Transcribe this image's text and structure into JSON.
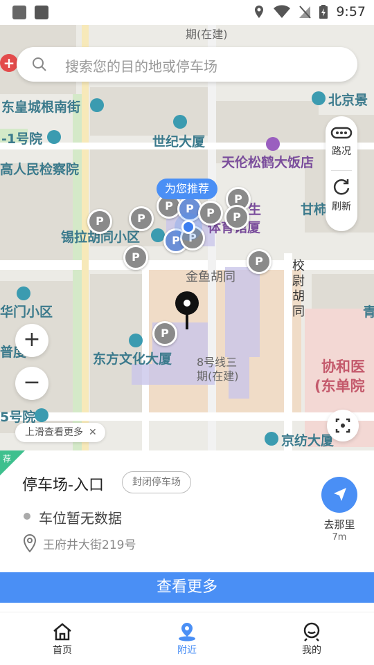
{
  "status_bar": {
    "time": "9:57"
  },
  "search": {
    "placeholder": "搜索您的目的地或停车场"
  },
  "map_controls": {
    "traffic_label": "路况",
    "refresh_label": "刷新",
    "zoom_in": "+",
    "zoom_out": "−"
  },
  "map_labels": {
    "station_top": "期(在建)",
    "east_imperial": "东皇城根南街",
    "beijing_view": "北京景",
    "hospital_1": "-1号院",
    "century_building": "世纪大厦",
    "procuratorate": "高人民检察院",
    "hotel": "天伦松鹤大饭店",
    "xila": "锡拉胡同小区",
    "stadium_a": "生",
    "stadium_b": "体育馆厦",
    "gan": "甘柿",
    "jinyu": "金鱼胡同",
    "xiaowei": "校尉胡同",
    "huamen": "华门小区",
    "qing": "青",
    "pu": "普度",
    "dongfang": "东方文化大厦",
    "line8": "8号线三",
    "line8b": "期(在建)",
    "xiehe": "协和医",
    "dongdan": "(东单院",
    "hao5": "5号院",
    "jingfang": "京纺大厦"
  },
  "recommend_bubble": "为您推荐",
  "swipe_hint": {
    "text": "上滑查看更多",
    "close": "✕"
  },
  "card": {
    "tag": "荐",
    "name": "停车场-入口",
    "badge": "封闭停车场",
    "spaces": "车位暂无数据",
    "address": "王府井大街219号",
    "go_label": "去那里",
    "distance": "7m"
  },
  "more_button": "查看更多",
  "nav": {
    "items": [
      {
        "label": "首页",
        "icon": "home-icon"
      },
      {
        "label": "附近",
        "icon": "location-person-icon"
      },
      {
        "label": "我的",
        "icon": "user-icon"
      }
    ]
  },
  "colors": {
    "accent": "#4a8ff5",
    "tag_green": "#3ec08e"
  }
}
